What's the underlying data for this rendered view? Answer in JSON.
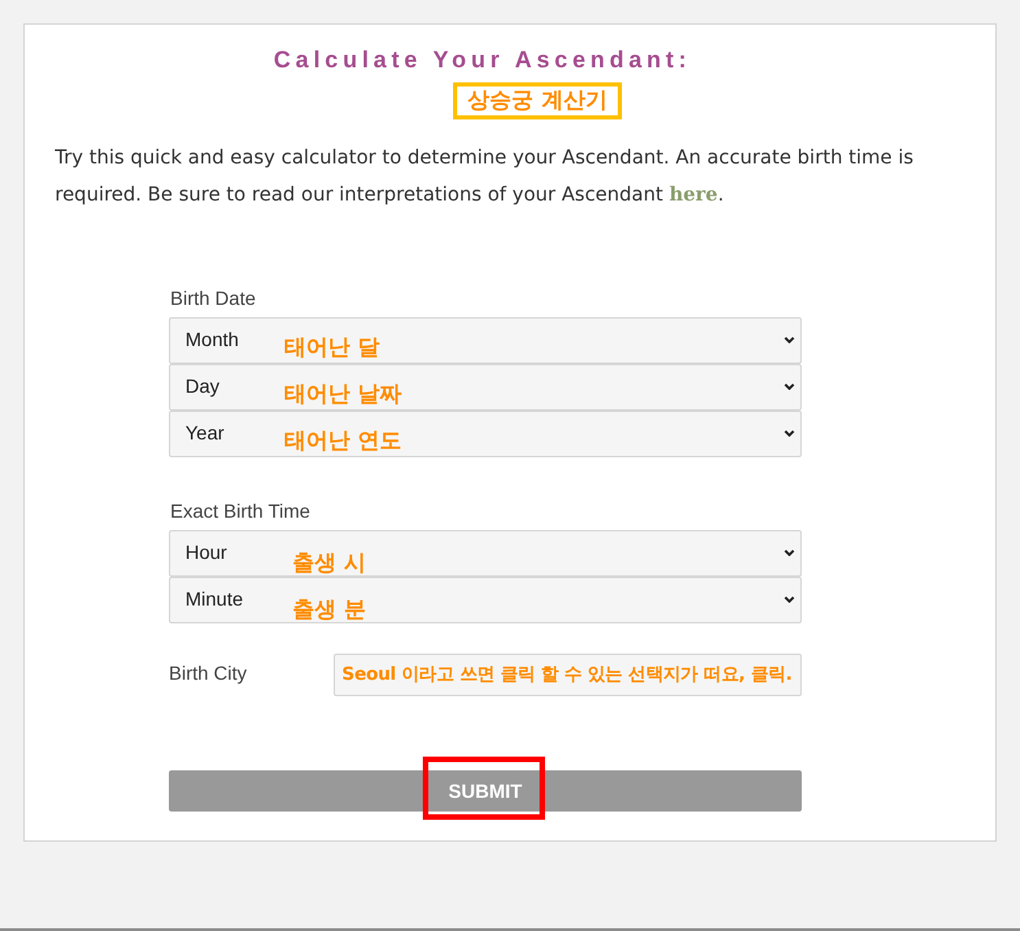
{
  "header": {
    "title": "Calculate Your Ascendant:",
    "annotation": "상승궁 계산기"
  },
  "intro": {
    "text": "Try this quick and easy calculator to determine your Ascendant. An accurate birth time is required. Be sure to read our interpretations of your Ascendant",
    "link": "here",
    "after": "."
  },
  "form": {
    "groups": [
      {
        "kind": "select",
        "label": "Birth Date",
        "fields": [
          {
            "value": "Month",
            "annotation": "태어난 달"
          },
          {
            "value": "Day",
            "annotation": "태어난 날짜"
          },
          {
            "value": "Year",
            "annotation": "태어난 연도"
          }
        ]
      },
      {
        "kind": "select",
        "label": "Exact Birth Time",
        "fields": [
          {
            "value": "Hour",
            "annotation": "출생 시"
          },
          {
            "value": "Minute",
            "annotation": "출생 분"
          }
        ]
      },
      {
        "kind": "text",
        "label": "Birth City",
        "annotation": "Seoul 이라고 쓰면 클릭 할 수 있는 선택지가 떠요, 클릭."
      }
    ]
  },
  "submit": {
    "label": "SUBMIT",
    "highlighted": true
  }
}
